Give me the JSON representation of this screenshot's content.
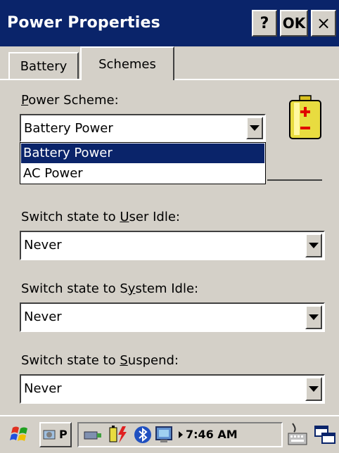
{
  "window": {
    "title": "Power Properties",
    "help_label": "?",
    "ok_label": "OK",
    "close_label": "×"
  },
  "tabs": [
    {
      "label": "Battery"
    },
    {
      "label": "Schemes"
    }
  ],
  "power_scheme": {
    "label_prefix": "",
    "label_accel": "P",
    "label_rest": "ower Scheme:",
    "value": "Battery Power",
    "options": [
      "Battery Power",
      "AC Power"
    ]
  },
  "user_idle": {
    "label_prefix": "Switch state to ",
    "label_accel": "U",
    "label_rest": "ser Idle:",
    "value": "Never"
  },
  "system_idle": {
    "label_prefix": "Switch state to S",
    "label_accel": "y",
    "label_rest": "stem Idle:",
    "value": "Never"
  },
  "suspend": {
    "label_prefix": "Switch state to ",
    "label_accel": "S",
    "label_rest": "uspend:",
    "value": "Never"
  },
  "taskbar": {
    "task_label": "P",
    "clock": "7:46 AM",
    "icons": [
      "start-flag-icon",
      "task-power-icon",
      "network-icon",
      "battery-icon",
      "bluetooth-icon",
      "monitor-icon",
      "tray-arrow-icon",
      "keyboard-icon",
      "windows-icon"
    ]
  },
  "colors": {
    "titlebar": "#0a246a",
    "selection": "#0a246a",
    "face": "#d4d0c8"
  }
}
